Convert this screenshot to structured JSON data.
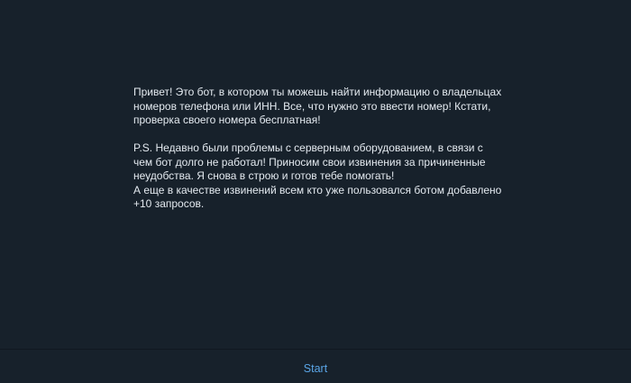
{
  "intro": {
    "paragraph1": [
      "Привет! Это бот, в котором ты можешь найти информацию о владельцах",
      "номеров телефона или ИНН. Все, что нужно это ввести номер! Кстати,",
      "проверка своего номера бесплатная!"
    ],
    "paragraph2": [
      "P.S. Недавно были проблемы с серверным оборудованием, в связи с",
      "чем бот долго не работал! Приносим свои извинения за причиненные",
      "неудобства. Я снова в строю и готов тебе помогать!",
      "А еще в качестве извинений всем кто уже пользовался ботом добавлено",
      "+10 запросов."
    ]
  },
  "bottom_bar": {
    "start_label": "Start"
  },
  "colors": {
    "background": "#17212b",
    "text": "#e4eaf0",
    "accent": "#5aa5e6"
  }
}
